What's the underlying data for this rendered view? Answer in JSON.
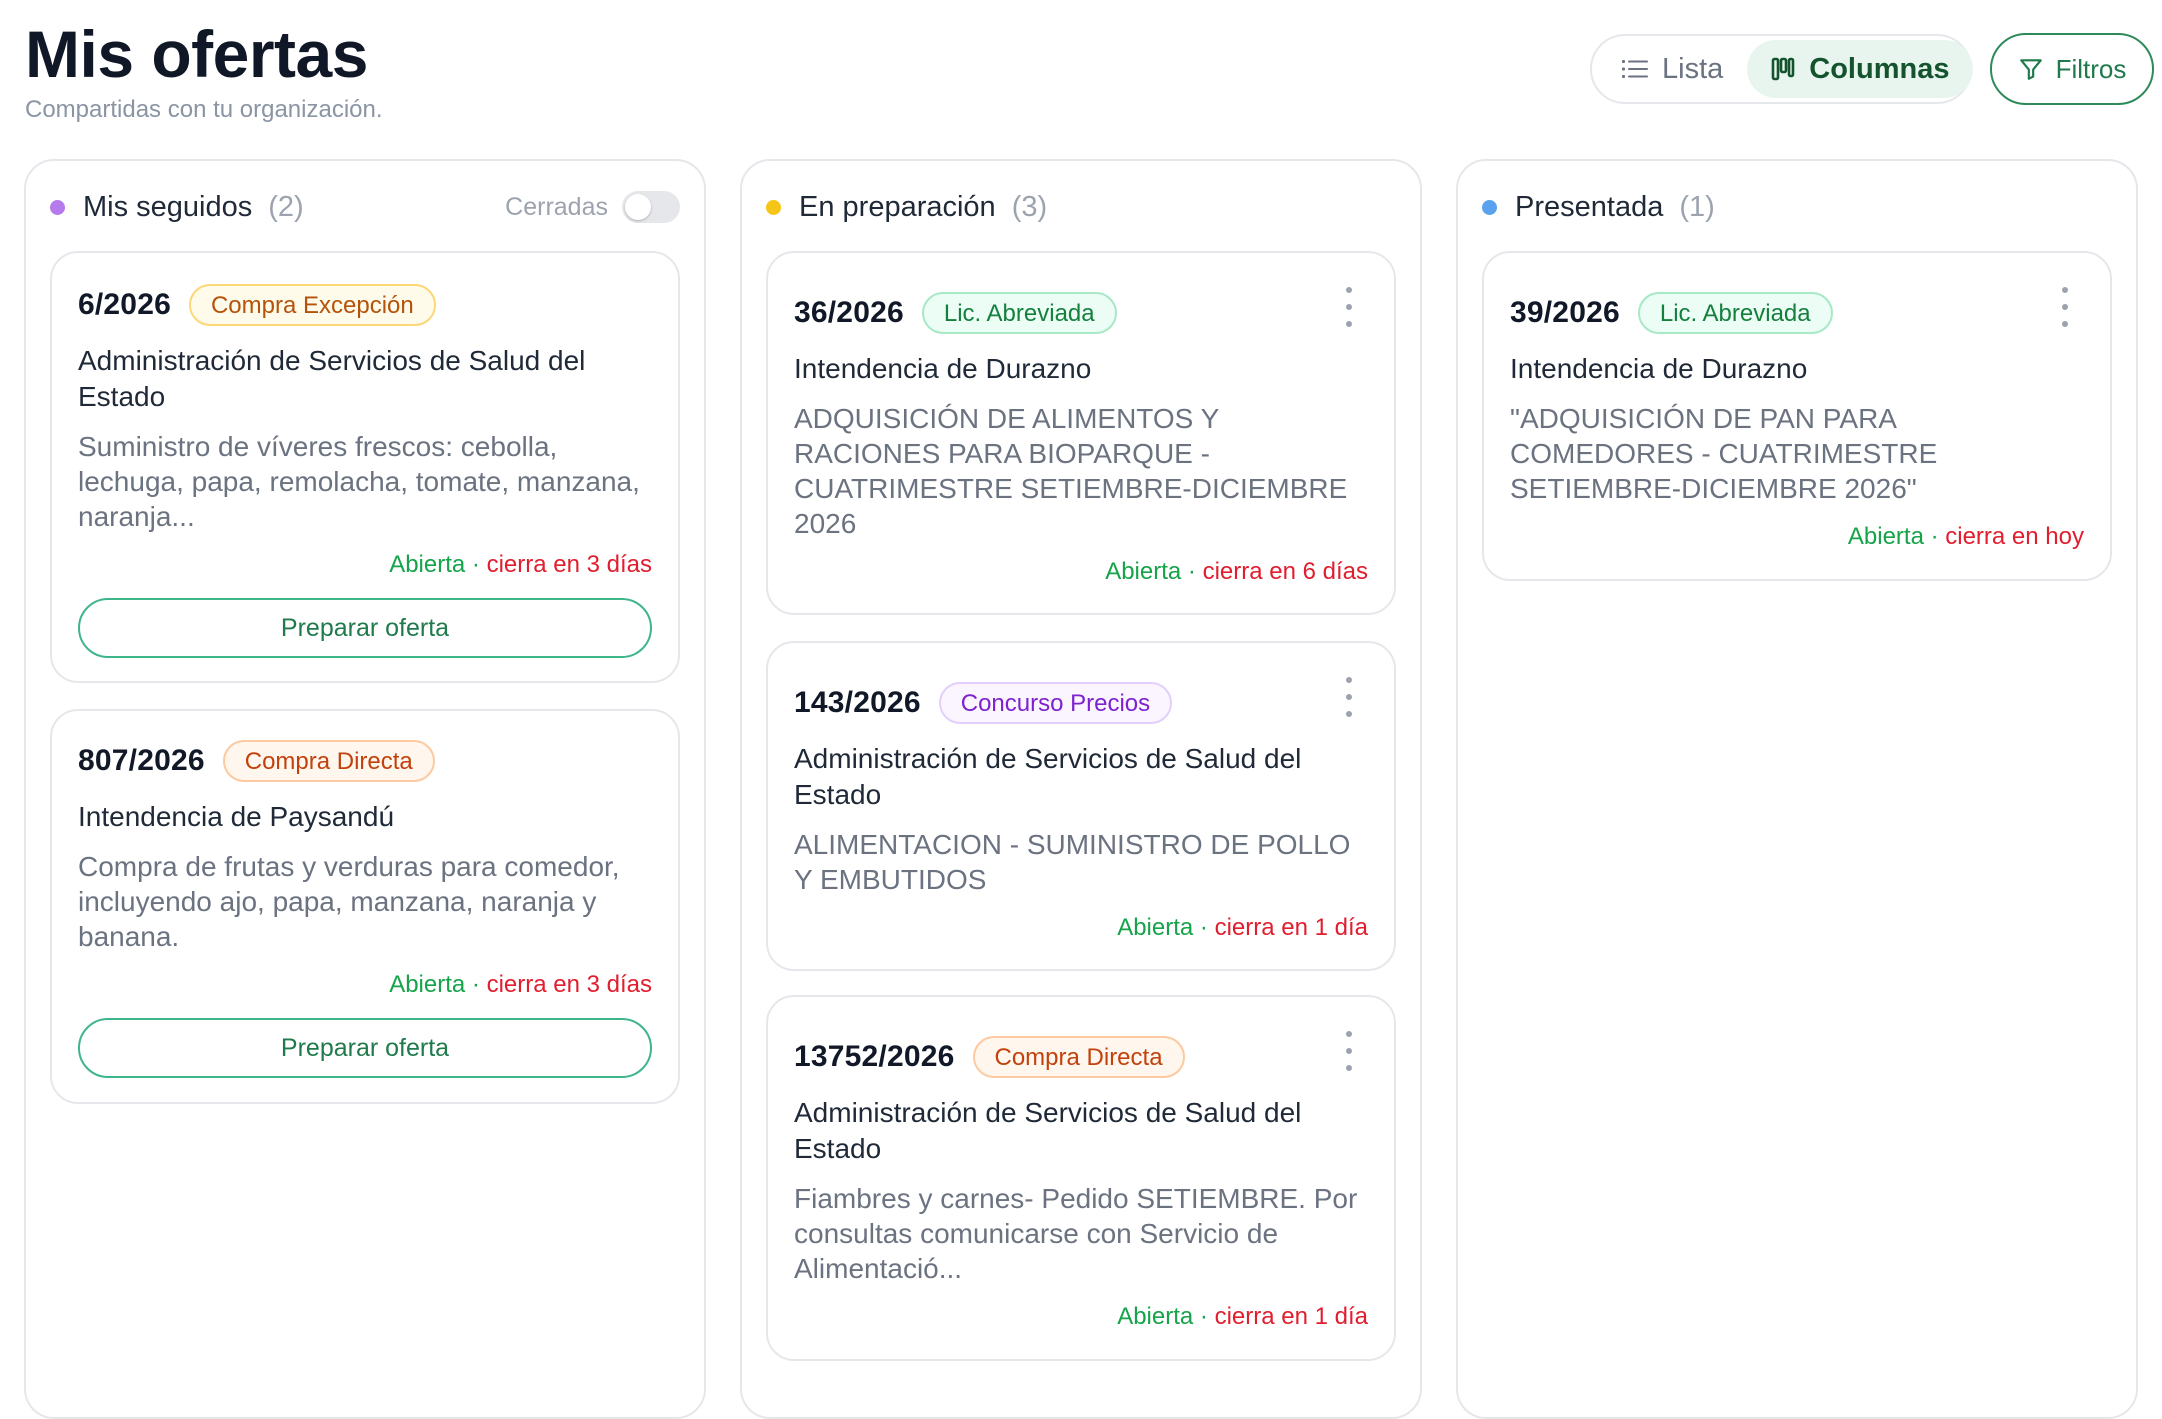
{
  "page": {
    "title": "Mis ofertas",
    "subtitle": "Compartidas con tu organización."
  },
  "toolbar": {
    "view_list": "Lista",
    "view_columns": "Columnas",
    "active_view": "Columnas",
    "filters": "Filtros"
  },
  "colors": {
    "mis_seguidos_dot": "#b57bec",
    "en_preparacion_dot": "#f5c518",
    "presentada_dot": "#5aa2ee",
    "open": "#16a34a",
    "closing": "#e11d2e"
  },
  "columns": [
    {
      "title": "Mis seguidos",
      "count": "(2)",
      "cerradas_label": "Cerradas",
      "cerradas_on": false,
      "cards": [
        {
          "id": "6/2026",
          "badge": "Compra Excepción",
          "org": "Administración de Servicios de Salud del Estado",
          "desc": "Suministro de víveres frescos: cebolla, lechuga, papa, remolacha, tomate, manzana, naranja...",
          "status": "Abierta",
          "sep": " · ",
          "closes": "cierra en 3 días",
          "action": "Preparar oferta"
        },
        {
          "id": "807/2026",
          "badge": "Compra Directa",
          "org": "Intendencia de Paysandú",
          "desc": "Compra de frutas y verduras para comedor, incluyendo ajo, papa, manzana, naranja y banana.",
          "status": "Abierta",
          "sep": " · ",
          "closes": "cierra en 3 días",
          "action": "Preparar oferta"
        }
      ]
    },
    {
      "title": "En preparación",
      "count": "(3)",
      "cards": [
        {
          "id": "36/2026",
          "badge": "Lic. Abreviada",
          "org": "Intendencia de Durazno",
          "desc": "ADQUISICIÓN DE ALIMENTOS Y RACIONES PARA BIOPARQUE - CUATRIMESTRE SETIEMBRE-DICIEMBRE 2026",
          "status": "Abierta",
          "sep": " · ",
          "closes": "cierra en 6 días"
        },
        {
          "id": "143/2026",
          "badge": "Concurso Precios",
          "org": "Administración de Servicios de Salud del Estado",
          "desc": "ALIMENTACION - SUMINISTRO DE POLLO Y EMBUTIDOS",
          "status": "Abierta",
          "sep": " · ",
          "closes": "cierra en 1 día"
        },
        {
          "id": "13752/2026",
          "badge": "Compra Directa",
          "org": "Administración de Servicios de Salud del Estado",
          "desc": "Fiambres y carnes- Pedido SETIEMBRE. Por consultas comunicarse con Servicio de Alimentació...",
          "status": "Abierta",
          "sep": " · ",
          "closes": "cierra en 1 día"
        }
      ]
    },
    {
      "title": "Presentada",
      "count": "(1)",
      "cards": [
        {
          "id": "39/2026",
          "badge": "Lic. Abreviada",
          "org": "Intendencia de Durazno",
          "desc": "\"ADQUISICIÓN DE PAN PARA COMEDORES - CUATRIMESTRE SETIEMBRE-DICIEMBRE 2026\"",
          "status": "Abierta",
          "sep": " · ",
          "closes": "cierra en hoy"
        }
      ]
    }
  ]
}
